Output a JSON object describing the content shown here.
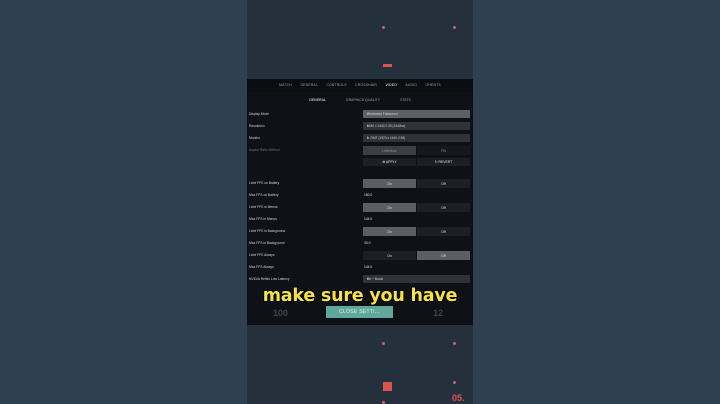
{
  "settings": {
    "top_nav": [
      "MATCH",
      "GENERAL",
      "CONTROLS",
      "CROSSHAIR",
      "VIDEO",
      "AUDIO",
      "OHENTS"
    ],
    "active_top_nav": "VIDEO",
    "sub_nav": [
      "GENERAL",
      "GRAPHICS QUALITY",
      "STATS"
    ],
    "active_sub_nav": "GENERAL",
    "rows": {
      "display_mode": {
        "label": "Display Mode",
        "value": "Windowed Fullscreen"
      },
      "resolution": {
        "label": "Resolution",
        "value": "1440 x 1440 2:39 (1440hz)"
      },
      "monitor": {
        "label": "Monitor",
        "value": "1. GMT (1920 x 1440 2:39)"
      },
      "aspect_ratio": {
        "label": "Aspect Ratio Method",
        "option_a": "Letterbox",
        "option_b": "Fill"
      },
      "apply_label": "⊕ APPLY",
      "revert_label": "↻ REVERT",
      "limit_fps_battery": {
        "label": "Limit FPS on Battery",
        "on": "On",
        "off": "Off"
      },
      "max_fps_battery": {
        "label": "Max FPS on Battery",
        "value": "160.0"
      },
      "limit_fps_menus": {
        "label": "Limit FPS in Menus",
        "on": "On",
        "off": "Off"
      },
      "max_fps_menus": {
        "label": "Max FPS in Menus",
        "value": "144.0"
      },
      "limit_fps_background": {
        "label": "Limit FPS in Background",
        "on": "On",
        "off": "Off"
      },
      "max_fps_background": {
        "label": "Max FPS in Background",
        "value": "30.0"
      },
      "limit_fps_always": {
        "label": "Limit FPS Always",
        "on": "On",
        "off": "Off"
      },
      "max_fps_always": {
        "label": "Max FPS Always",
        "value": "144.0"
      },
      "nvidia_reflex": {
        "label": "NVIDIA Reflex Low Latency",
        "value": "On + Boost"
      }
    },
    "close_label": "CLOSE SETTI...",
    "ghost_left": "100",
    "ghost_right": "12"
  },
  "caption": "make sure you have",
  "corner_number": "05.",
  "colors": {
    "caption": "#f7e24a",
    "close_button": "#5fa89a",
    "accent_red": "#d9534f"
  }
}
